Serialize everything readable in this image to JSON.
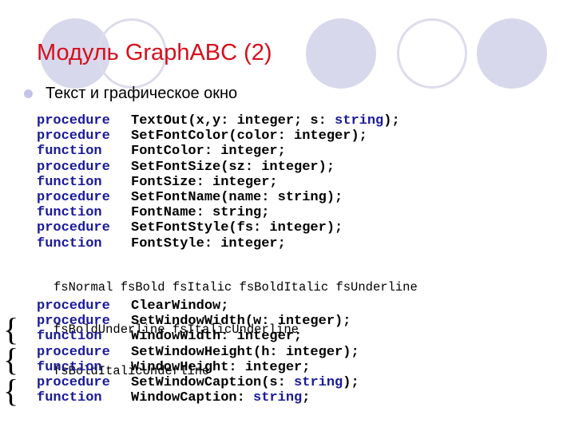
{
  "slide": {
    "title": "Модуль GraphABC (2)",
    "bullet": "Текст и графическое окно",
    "colors": {
      "title": "#d4101c",
      "keyword": "#1a1a9a",
      "decor_circle": "#d8d8ec"
    }
  },
  "text_block": [
    {
      "kw": "procedure",
      "pre": "TextOut(x,y: integer; s: ",
      "type": "string",
      "post": ");"
    },
    {
      "kw": "procedure",
      "pre": "SetFontColor(color: integer);",
      "type": "",
      "post": ""
    },
    {
      "kw": "function",
      "pre": "FontColor: integer;",
      "type": "",
      "post": ""
    },
    {
      "kw": "procedure",
      "pre": "SetFontSize(sz: integer);",
      "type": "",
      "post": ""
    },
    {
      "kw": "function",
      "pre": "FontSize: integer;",
      "type": "",
      "post": ""
    },
    {
      "kw": "procedure",
      "pre": "SetFontName(name: string);",
      "type": "",
      "post": ""
    },
    {
      "kw": "function",
      "pre": "FontName: string;",
      "type": "",
      "post": ""
    },
    {
      "kw": "procedure",
      "pre": "SetFontStyle(fs: integer);",
      "type": "",
      "post": ""
    },
    {
      "kw": "function",
      "pre": "FontStyle: integer;",
      "type": "",
      "post": ""
    }
  ],
  "font_styles": [
    "fsNormal fsBold fsItalic fsBoldItalic fsUnderline",
    "fsBoldUnderline fsItalicUnderline",
    "fsBoldItalicUnderline"
  ],
  "window_block": [
    {
      "kw": "procedure",
      "pre": "ClearWindow;",
      "type": "",
      "post": ""
    },
    {
      "kw": "procedure",
      "pre": "SetWindowWidth(w: integer);",
      "type": "",
      "post": ""
    },
    {
      "kw": "function",
      "pre": "WindowWidth: integer;",
      "type": "",
      "post": ""
    },
    {
      "kw": "procedure",
      "pre": "SetWindowHeight(h: integer);",
      "type": "",
      "post": ""
    },
    {
      "kw": "function",
      "pre": "WindowHeight: integer;",
      "type": "",
      "post": ""
    },
    {
      "kw": "procedure",
      "pre": "SetWindowCaption(s: ",
      "type": "string",
      "post": ");"
    },
    {
      "kw": "function",
      "pre": "WindowCaption: ",
      "type": "string",
      "post": ";"
    }
  ],
  "braces": [
    "{",
    "{",
    "{"
  ]
}
